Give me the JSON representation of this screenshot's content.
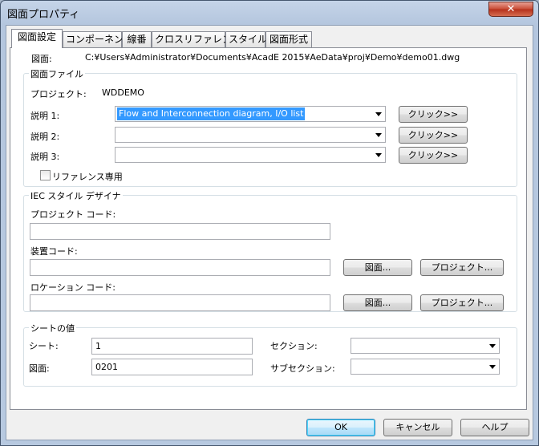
{
  "window": {
    "title": "図面プロパティ",
    "close_label": "✕"
  },
  "tabs": [
    {
      "label": "図面設定",
      "active": true
    },
    {
      "label": "コンポーネント",
      "active": false
    },
    {
      "label": "線番",
      "active": false
    },
    {
      "label": "クロスリファレンス",
      "active": false
    },
    {
      "label": "スタイル",
      "active": false
    },
    {
      "label": "図面形式",
      "active": false
    }
  ],
  "drawing": {
    "label": "図面:",
    "path": "C:¥Users¥Administrator¥Documents¥AcadE 2015¥AeData¥proj¥Demo¥demo01.dwg"
  },
  "drawing_file": {
    "group_title": "図面ファイル",
    "project_label": "プロジェクト:",
    "project_value": "WDDEMO",
    "descriptions": [
      {
        "label": "説明 1:",
        "value": "Flow and Interconnection diagram, I/O list",
        "button": "クリック>>"
      },
      {
        "label": "説明 2:",
        "value": "",
        "button": "クリック>>"
      },
      {
        "label": "説明 3:",
        "value": "",
        "button": "クリック>>"
      }
    ],
    "reference_only_label": "リファレンス専用",
    "reference_only_checked": false
  },
  "iec": {
    "group_title": "IEC スタイル デザイナ",
    "project_code_label": "プロジェクト コード:",
    "project_code_value": "",
    "installation_code_label": "装置コード:",
    "installation_code_value": "",
    "location_code_label": "ロケーション コード:",
    "location_code_value": "",
    "drawing_button": "図面...",
    "project_button": "プロジェクト..."
  },
  "sheet": {
    "group_title": "シートの値",
    "sheet_label": "シート:",
    "sheet_value": "1",
    "drawing_label": "図面:",
    "drawing_value": "0201",
    "section_label": "セクション:",
    "section_value": "",
    "subsection_label": "サブセクション:",
    "subsection_value": ""
  },
  "footer": {
    "ok": "OK",
    "cancel": "キャンセル",
    "help": "ヘルプ"
  }
}
